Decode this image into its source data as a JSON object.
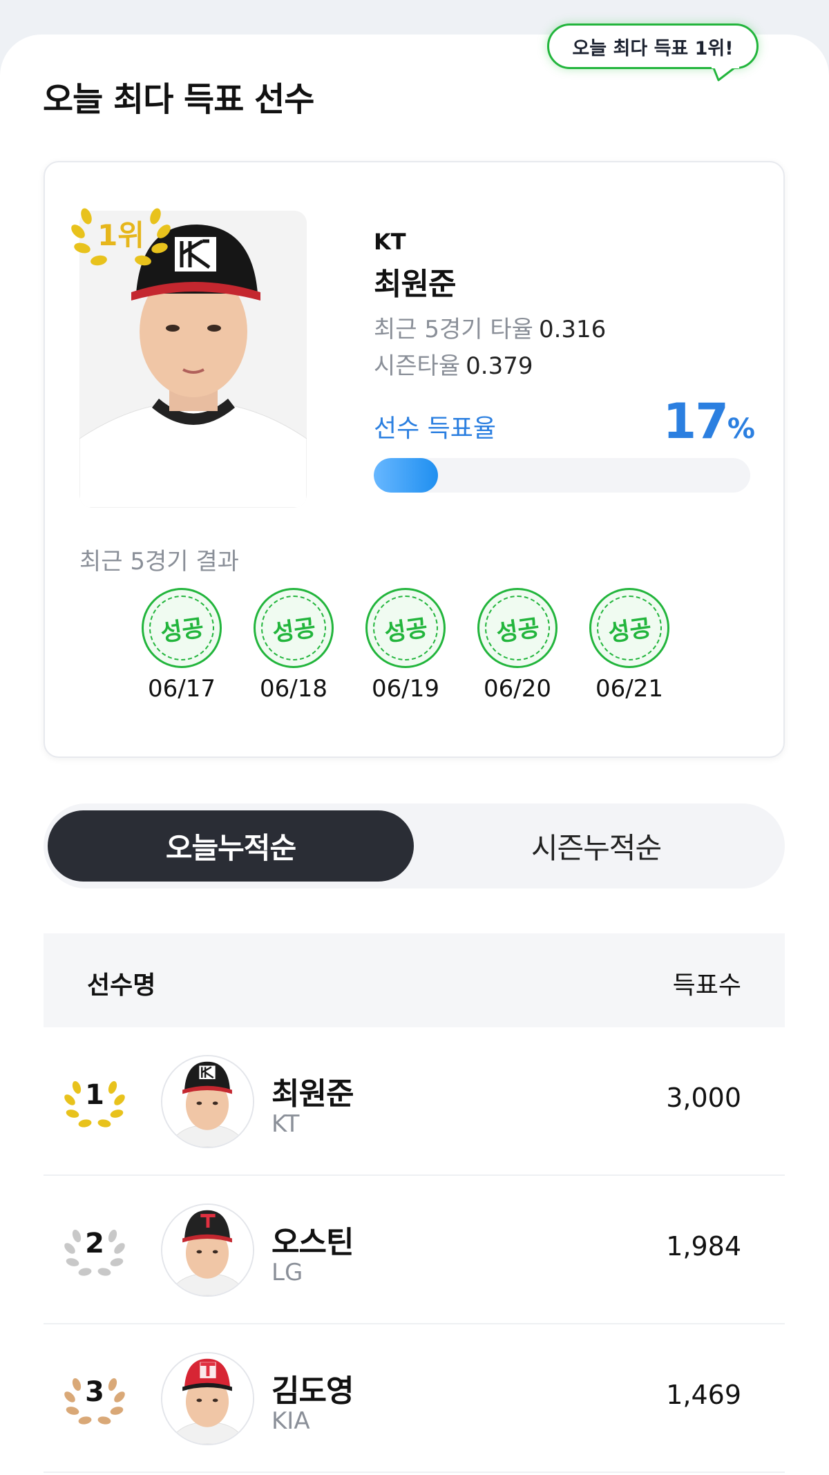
{
  "bubble": {
    "text": "오늘 최다 득표 1위!"
  },
  "page_title": "오늘 최다 득표 선수",
  "top_player": {
    "rank_label": "1위",
    "team": "KT",
    "name": "최원준",
    "stat1_label": "최근 5경기 타율",
    "stat1_value": "0.316",
    "stat2_label": "시즌타율",
    "stat2_value": "0.379",
    "vote_label": "선수 득표율",
    "vote_value": "17",
    "vote_unit": "%",
    "vote_fraction": 0.17,
    "recent_label": "최근 5경기 결과",
    "recent_games": [
      {
        "result": "성공",
        "date": "06/17"
      },
      {
        "result": "성공",
        "date": "06/18"
      },
      {
        "result": "성공",
        "date": "06/19"
      },
      {
        "result": "성공",
        "date": "06/20"
      },
      {
        "result": "성공",
        "date": "06/21"
      }
    ]
  },
  "tabs": [
    {
      "label": "오늘누적순",
      "active": true
    },
    {
      "label": "시즌누적순",
      "active": false
    }
  ],
  "table": {
    "col_name": "선수명",
    "col_votes": "득표수",
    "rows": [
      {
        "rank": "1",
        "name": "최원준",
        "team": "KT",
        "votes": "3,000",
        "medal_color": "#e8c21c",
        "cap_color": "#1b1b1b",
        "cap_logo": "KT"
      },
      {
        "rank": "2",
        "name": "오스틴",
        "team": "LG",
        "votes": "1,984",
        "medal_color": "#c8c8c8",
        "cap_color": "#222222",
        "cap_logo": "T"
      },
      {
        "rank": "3",
        "name": "김도영",
        "team": "KIA",
        "votes": "1,469",
        "medal_color": "#d9a877",
        "cap_color": "#d72534",
        "cap_logo": "T"
      }
    ]
  },
  "colors": {
    "accent_blue": "#2b7fe0",
    "success_green": "#22b53c",
    "dark_tab": "#2a2d35"
  }
}
